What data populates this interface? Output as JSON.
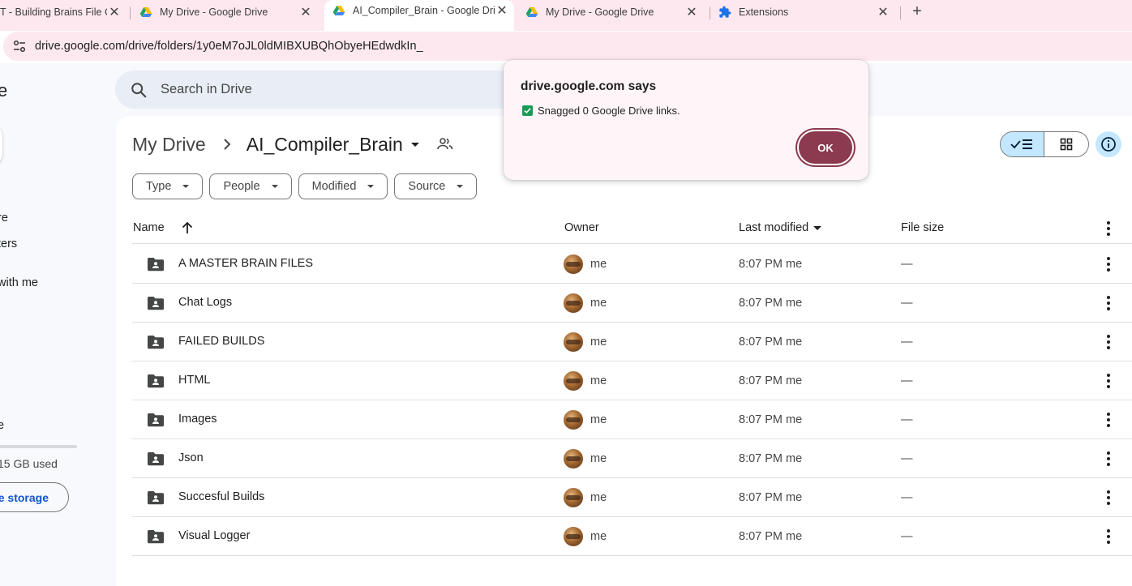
{
  "browser": {
    "tabs": [
      {
        "title": "T - Building Brains File C",
        "favicon": "generic-page-icon"
      },
      {
        "title": "My Drive - Google Drive",
        "favicon": "google-drive-icon"
      },
      {
        "title": "AI_Compiler_Brain - Google Dri",
        "favicon": "google-drive-icon",
        "active": true
      },
      {
        "title": "My Drive - Google Drive",
        "favicon": "google-drive-icon"
      },
      {
        "title": "Extensions",
        "favicon": "puzzle-icon"
      }
    ],
    "new_tab_label": "+",
    "url": "drive.google.com/drive/folders/1y0eM7oJL0ldMIBXUBQhObyeHEdwdkIn_"
  },
  "sidebar": {
    "brand_partial": "e",
    "items_partial": [
      {
        "label": "re"
      },
      {
        "label": "ters"
      },
      {
        "label": " with me"
      },
      {
        "label": "e"
      }
    ],
    "storage_text": "15 GB used",
    "storage_button": "e storage"
  },
  "search": {
    "placeholder": "Search in Drive"
  },
  "breadcrumb": {
    "root": "My Drive",
    "current": "AI_Compiler_Brain"
  },
  "filters": [
    "Type",
    "People",
    "Modified",
    "Source"
  ],
  "table": {
    "headers": {
      "name": "Name",
      "owner": "Owner",
      "last_modified": "Last modified",
      "file_size": "File size"
    },
    "rows": [
      {
        "name": "A MASTER BRAIN FILES",
        "owner": "me",
        "modified": "8:07 PM  me",
        "size": "—"
      },
      {
        "name": "Chat Logs",
        "owner": "me",
        "modified": "8:07 PM  me",
        "size": "—"
      },
      {
        "name": "FAILED BUILDS",
        "owner": "me",
        "modified": "8:07 PM  me",
        "size": "—"
      },
      {
        "name": "HTML",
        "owner": "me",
        "modified": "8:07 PM  me",
        "size": "—"
      },
      {
        "name": "Images",
        "owner": "me",
        "modified": "8:07 PM  me",
        "size": "—"
      },
      {
        "name": "Json",
        "owner": "me",
        "modified": "8:07 PM  me",
        "size": "—"
      },
      {
        "name": "Succesful Builds",
        "owner": "me",
        "modified": "8:07 PM  me",
        "size": "—"
      },
      {
        "name": "Visual Logger",
        "owner": "me",
        "modified": "8:07 PM  me",
        "size": "—"
      }
    ]
  },
  "dialog": {
    "title": "drive.google.com says",
    "message": "Snagged 0 Google Drive links.",
    "ok_label": "OK"
  },
  "colors": {
    "tabstrip_bg": "#fce8ee",
    "dialog_ok": "#8b3a4f",
    "view_toggle_active": "#c2e7ff",
    "checkbox_green": "#1a9a54"
  }
}
